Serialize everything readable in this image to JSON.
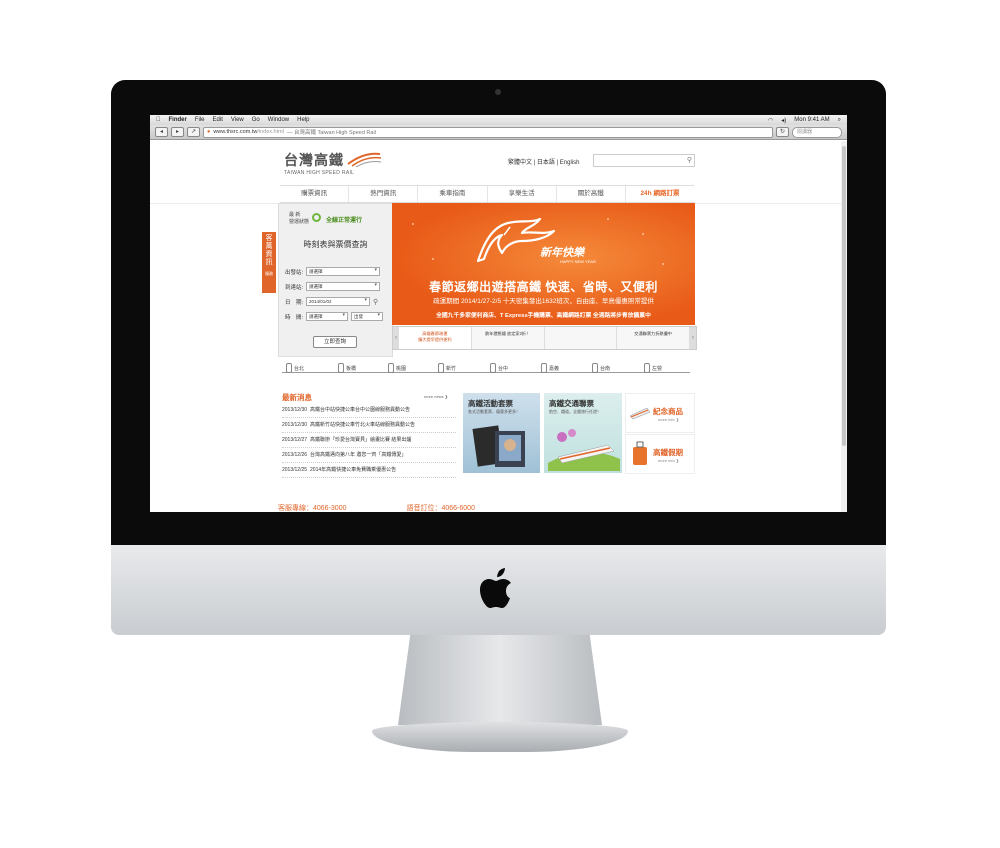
{
  "menubar": {
    "apple": "",
    "items": [
      "Finder",
      "File",
      "Edit",
      "View",
      "Go",
      "Window",
      "Help"
    ],
    "clock": "Mon 9:41 AM"
  },
  "browser": {
    "url": "www.thsrc.com.tw",
    "url_path": "/index.html",
    "page_title": "— 台灣高鐵 Taiwan High Speed Rail",
    "search_placeholder": "閱讀器"
  },
  "site": {
    "logo_zh": "台灣高鐵",
    "logo_en": "TAIWAN HIGH SPEED RAIL",
    "languages": "繁體中文 | 日本語 | English",
    "nav": [
      "購票資訊",
      "熱門資訊",
      "乘車指南",
      "享樂生活",
      "關於高鐵",
      "24h 網路訂票"
    ]
  },
  "side_tab": {
    "label": "客 萬 資 訊",
    "small": "服務"
  },
  "status": {
    "label": "最 新\n營運狀態",
    "value": "全線正常運行"
  },
  "query": {
    "title": "時刻表與票價查詢",
    "from_label": "出發站:",
    "from_value": "請選擇",
    "to_label": "到達站:",
    "to_value": "請選擇",
    "date_label": "日　期:",
    "date_value": "2014/01/02",
    "time_label": "時　間:",
    "time_value": "請選擇",
    "dir_value": "出發",
    "submit": "立即查詢"
  },
  "banner": {
    "ny_zh": "新年快樂",
    "ny_en": "HAPPY NEW YEAR",
    "headline": "春節返鄉出遊搭高鐵 快速、省時、又便利",
    "sub": "疏運期間 2014/1/27-2/5 十天密集發出1632班次，自由座、早鳥優惠照常提供",
    "sub2": "全國九千多家便利商店、T Express手機購票、高鐵網路訂票 全適路將步青放鶴禀中"
  },
  "banner_thumbs": [
    {
      "text": "高鐵春節疏運\n擴大提早提供便利",
      "active": true
    },
    {
      "text": "熱年穩態鐵 放定家2折！",
      "active": false
    },
    {
      "text": "",
      "active": false
    },
    {
      "text": "交通聯票力折熱優中",
      "active": false
    }
  ],
  "stations": [
    "台北",
    "板橋",
    "桃園",
    "新竹",
    "台中",
    "嘉義",
    "台南",
    "左營"
  ],
  "news": {
    "title": "最新消息",
    "more": "more news ❯",
    "items": [
      {
        "date": "2013/12/30",
        "text": "高鐵台中站快捷公車台中公園線服務異動公告"
      },
      {
        "date": "2013/12/30",
        "text": "高鐵新竹站快捷公車竹北火車站線服務異動公告"
      },
      {
        "date": "2013/12/27",
        "text": "高鐵聯辦「珍愛台灣寶貝」繪畫比賽 結果出爐"
      },
      {
        "date": "2013/12/26",
        "text": "台灣高鐵邁向第八年 邀您一齊「高鐵傳愛」"
      },
      {
        "date": "2013/12/25",
        "text": "2014年高鐵快捷公車免費職乘優惠公告"
      }
    ]
  },
  "promos": {
    "activity_title": "高鐵活動套票",
    "activity_sub": "各式活動套票，優惠多更多！",
    "joint_title": "高鐵交通聯票",
    "joint_sub": "航空、鐵道，全國旅行任遊！",
    "souvenir": "紀念商品",
    "holiday": "高鐵假期",
    "more_info": "more info ❯"
  },
  "footer": {
    "service": "客服專線：4066-3000",
    "booking": "語音訂位：4066-6000"
  },
  "colors": {
    "brand": "#e0652a",
    "status_green": "#6fb63a"
  }
}
